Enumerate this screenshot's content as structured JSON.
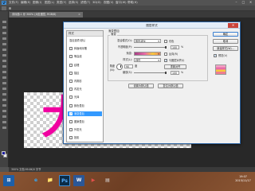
{
  "app": {
    "logo": "Ps",
    "menu": [
      "文件(F)",
      "编辑(E)",
      "图像(I)",
      "图层(L)",
      "类型(Y)",
      "选择(S)",
      "滤镜(T)",
      "3D(D)",
      "视图(V)",
      "窗口(W)",
      "帮助(H)"
    ],
    "window_controls": [
      "–",
      "□",
      "✕"
    ],
    "doc_tab": "未标题-1 @ 300% (大肚图层, RGB/8)",
    "doc_tab_close": "×",
    "canvas_text": "大肚",
    "status": "300%  文档:99.6K/0 字节"
  },
  "dialog": {
    "title": "图层样式",
    "close": "✕",
    "styles_header": "样式",
    "styles": [
      {
        "label": "混合选项:默认",
        "checkbox": false,
        "checked": false,
        "selected": false
      },
      {
        "label": "斜面和浮雕",
        "checkbox": true,
        "checked": false,
        "selected": false
      },
      {
        "label": "等高线",
        "checkbox": true,
        "checked": false,
        "selected": false
      },
      {
        "label": "纹理",
        "checkbox": true,
        "checked": false,
        "selected": false
      },
      {
        "label": "描边",
        "checkbox": true,
        "checked": false,
        "selected": false
      },
      {
        "label": "内阴影",
        "checkbox": true,
        "checked": false,
        "selected": false
      },
      {
        "label": "内发光",
        "checkbox": true,
        "checked": false,
        "selected": false
      },
      {
        "label": "光泽",
        "checkbox": true,
        "checked": false,
        "selected": false
      },
      {
        "label": "颜色叠加",
        "checkbox": true,
        "checked": false,
        "selected": false
      },
      {
        "label": "渐变叠加",
        "checkbox": true,
        "checked": true,
        "selected": true
      },
      {
        "label": "图案叠加",
        "checkbox": true,
        "checked": false,
        "selected": false
      },
      {
        "label": "外发光",
        "checkbox": true,
        "checked": false,
        "selected": false
      },
      {
        "label": "投影",
        "checkbox": true,
        "checked": false,
        "selected": false
      }
    ],
    "section_title": "渐变叠加",
    "group_title": "渐变",
    "blend_mode_label": "混合模式(O):",
    "blend_mode_value": "颜色减淡",
    "dither_label": "仿色",
    "opacity_label": "不透明度(P):",
    "opacity_value": "100",
    "opacity_fraction": 1.0,
    "gradient_label": "渐变:",
    "reverse_label": "反向(R)",
    "style_label": "样式(L):",
    "style_value": "线性",
    "align_label": "与图层对齐(I)",
    "angle_label": "角度(N):",
    "angle_value": "90",
    "degree": "度",
    "reset_align_button": "重置对齐",
    "scale_label": "缩放(S):",
    "scale_value": "100",
    "scale_fraction": 1.0,
    "percent": "%",
    "default_button": "设置为默认值",
    "reset_default_button": "复位为默认值",
    "ok_button": "确定",
    "cancel_button": "取消",
    "new_style_button": "新建样式(W)...",
    "preview_label": "预览(V)",
    "preview_checked": true
  },
  "taskbar": {
    "icons": [
      "e",
      "📁",
      "Ps",
      "W",
      "▶",
      "▤"
    ],
    "time": "19:07",
    "date": "2015/11/17"
  }
}
